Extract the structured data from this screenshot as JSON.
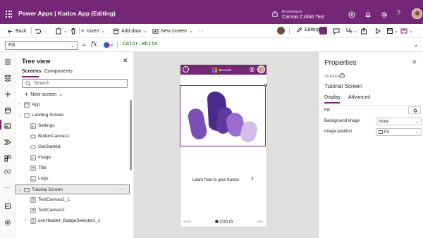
{
  "app": {
    "product": "Power Apps",
    "title": "Power Apps  |  Kudos App (Editing)",
    "environment_label": "Environment",
    "environment_name": "Canvas Collab Test",
    "brand_color": "#742774"
  },
  "cmdbar": {
    "back": "Back",
    "insert": "Insert",
    "add_data": "Add data",
    "new_screen": "New screen",
    "more": "···",
    "editing": "Editing"
  },
  "formula": {
    "property": "Fill",
    "eq": "=",
    "fx": "fx",
    "value": "Color.White"
  },
  "tree": {
    "title": "Tree view",
    "tabs": [
      "Screens",
      "Components"
    ],
    "search_placeholder": "Search",
    "new_screen": "New screen",
    "items": [
      {
        "label": "App",
        "type": "app"
      },
      {
        "label": "Landing Screen",
        "type": "screen"
      },
      {
        "label": "Settings",
        "type": "image"
      },
      {
        "label": "ButtonCanvas1",
        "type": "button"
      },
      {
        "label": "GetStarted",
        "type": "button"
      },
      {
        "label": "Image",
        "type": "image"
      },
      {
        "label": "Title",
        "type": "text"
      },
      {
        "label": "Logo",
        "type": "image"
      },
      {
        "label": "Tutorial Screen",
        "type": "screen",
        "selected": true
      },
      {
        "label": "TextCanvas2_1",
        "type": "text"
      },
      {
        "label": "TextCanvas2",
        "type": "text"
      },
      {
        "label": "conHeader_BadgeSelection_1",
        "type": "container"
      }
    ]
  },
  "phone": {
    "logo_text": "Microsoft",
    "tagline": "Learn how to give Kudos",
    "home": "Home",
    "skip": "Skip",
    "page_dots": 4,
    "active_dot": 1
  },
  "properties": {
    "title": "Properties",
    "type_label": "SCREEN",
    "screen_name": "Tutorial Screen",
    "tabs": [
      "Display",
      "Advanced"
    ],
    "fill_label": "Fill",
    "bg_image_label": "Background image",
    "bg_image_value": "None",
    "image_position_label": "Image position",
    "image_position_value": "Fit"
  }
}
